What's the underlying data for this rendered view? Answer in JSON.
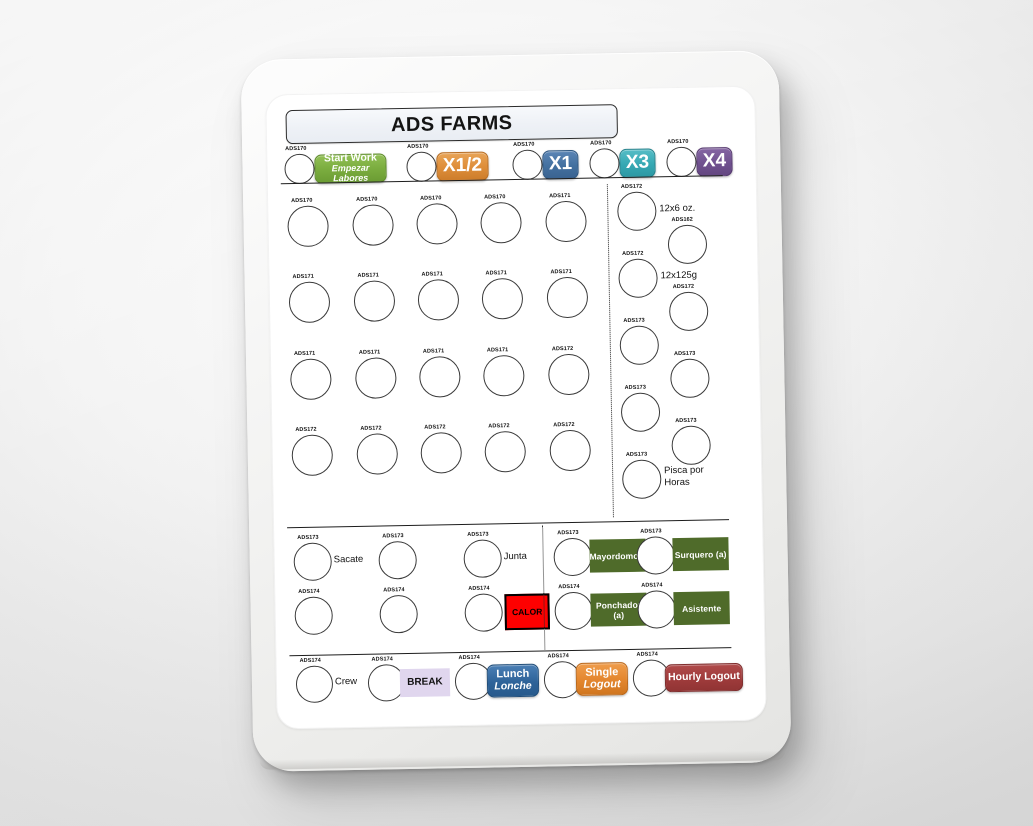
{
  "app": {
    "title": "ADS FARMS",
    "device": "tablet"
  },
  "colors": {
    "green": "#7cae40",
    "orange": "#df8f3b",
    "steel_blue": "#43709f",
    "teal": "#35a8b3",
    "purple": "#70518f",
    "role_green": "#4f6b2a",
    "calor_red": "#fe0000",
    "break_lavender": "#e0d6ee",
    "lunch_blue": "#2e6399",
    "single_orange": "#e4872f",
    "hourly_maroon": "#a03c3c",
    "title_bg": "#eef1f6"
  },
  "top_row": [
    {
      "code": "ADS170",
      "button": {
        "label": "Start Work",
        "sublabel": "Empezar Labores",
        "style": "green"
      }
    },
    {
      "code": "ADS170",
      "button": {
        "label": "X1/2",
        "sublabel": "",
        "style": "orange"
      }
    },
    {
      "code": "ADS170",
      "button": {
        "label": "X1",
        "sublabel": "",
        "style": "steel"
      }
    },
    {
      "code": "ADS170",
      "button": {
        "label": "X3",
        "sublabel": "",
        "style": "teal"
      }
    },
    {
      "code": "ADS170",
      "button": {
        "label": "X4",
        "sublabel": "",
        "style": "purple"
      }
    }
  ],
  "main_grid": {
    "rows": [
      {
        "cells": [
          {
            "code": "ADS170"
          },
          {
            "code": "ADS170"
          },
          {
            "code": "ADS170"
          },
          {
            "code": "ADS170"
          },
          {
            "code": "ADS171"
          }
        ]
      },
      {
        "cells": [
          {
            "code": "ADS171"
          },
          {
            "code": "ADS171"
          },
          {
            "code": "ADS171"
          },
          {
            "code": "ADS171"
          },
          {
            "code": "ADS171"
          }
        ]
      },
      {
        "cells": [
          {
            "code": "ADS171"
          },
          {
            "code": "ADS171"
          },
          {
            "code": "ADS171"
          },
          {
            "code": "ADS171"
          },
          {
            "code": "ADS172"
          }
        ]
      },
      {
        "cells": [
          {
            "code": "ADS172"
          },
          {
            "code": "ADS172"
          },
          {
            "code": "ADS172"
          },
          {
            "code": "ADS172"
          },
          {
            "code": "ADS172"
          }
        ]
      }
    ]
  },
  "right_column": [
    {
      "code": "ADS172",
      "caption": "12x6 oz.",
      "column": "left"
    },
    {
      "code": "ADS162",
      "caption": "",
      "column": "right"
    },
    {
      "code": "ADS172",
      "caption": "12x125g",
      "column": "left"
    },
    {
      "code": "ADS172",
      "caption": "",
      "column": "right"
    },
    {
      "code": "ADS173",
      "caption": "",
      "column": "left"
    },
    {
      "code": "ADS173",
      "caption": "",
      "column": "right"
    },
    {
      "code": "ADS173",
      "caption": "",
      "column": "left"
    },
    {
      "code": "ADS173",
      "caption": "",
      "column": "right"
    },
    {
      "code": "ADS173",
      "caption": "Pisca por Horas",
      "column": "left"
    }
  ],
  "task_section": {
    "left": [
      {
        "code": "ADS173",
        "caption": "Sacate"
      },
      {
        "code": "ADS173",
        "caption": ""
      },
      {
        "code": "ADS173",
        "caption": "Junta"
      },
      {
        "code": "ADS174",
        "caption": ""
      },
      {
        "code": "ADS174",
        "caption": ""
      },
      {
        "code": "ADS174",
        "caption": "",
        "button": {
          "label": "CALOR",
          "style": "calor"
        }
      }
    ],
    "right": [
      {
        "code": "ADS173",
        "button": {
          "label": "Mayordomo/a",
          "style": "role"
        }
      },
      {
        "code": "ADS173",
        "button": {
          "label": "Surquero (a)",
          "style": "role"
        }
      },
      {
        "code": "ADS174",
        "button": {
          "label": "Ponchador (a)",
          "style": "role"
        }
      },
      {
        "code": "ADS174",
        "button": {
          "label": "Asistente",
          "style": "role"
        }
      }
    ]
  },
  "bottom_row": [
    {
      "code": "ADS174",
      "caption": "Crew"
    },
    {
      "code": "ADS174",
      "button": {
        "label": "BREAK",
        "sublabel": "",
        "style": "break"
      }
    },
    {
      "code": "ADS174",
      "button": {
        "label": "Lunch",
        "sublabel": "Lonche",
        "style": "lunch"
      }
    },
    {
      "code": "ADS174",
      "button": {
        "label": "Single",
        "sublabel": "Logout",
        "style": "single"
      }
    },
    {
      "code": "ADS174",
      "button": {
        "label": "Hourly Logout",
        "sublabel": "",
        "style": "hourly"
      }
    }
  ]
}
